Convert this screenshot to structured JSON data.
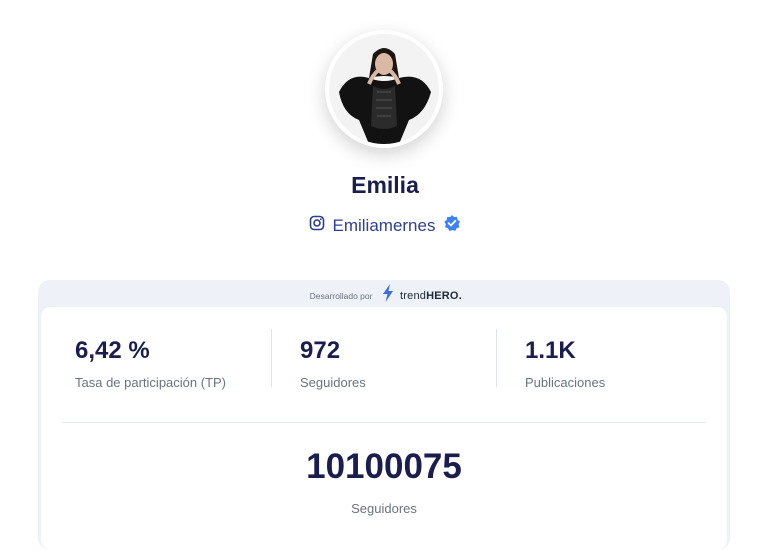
{
  "profile": {
    "name": "Emilia",
    "handle": "Emiliamernes",
    "platform_icon": "instagram-icon",
    "verified_icon": "verified-badge-icon",
    "verified_color": "#3b82f6"
  },
  "powered_by": {
    "text": "Desarrollado por",
    "brand_prefix": "trend",
    "brand_suffix": "HERO.",
    "brand_icon": "lightning-bolt-icon",
    "brand_color": "#3b6fe0"
  },
  "stats": [
    {
      "value": "6,42 %",
      "label": "Tasa de participación (TP)"
    },
    {
      "value": "972",
      "label": "Seguidores"
    },
    {
      "value": "1.1K",
      "label": "Publicaciones"
    }
  ],
  "highlight": {
    "value": "10100075",
    "label": "Seguidores"
  },
  "colors": {
    "primary_text": "#1a1d4e",
    "muted_text": "#6b7280",
    "card_bg": "#eef2f8"
  }
}
